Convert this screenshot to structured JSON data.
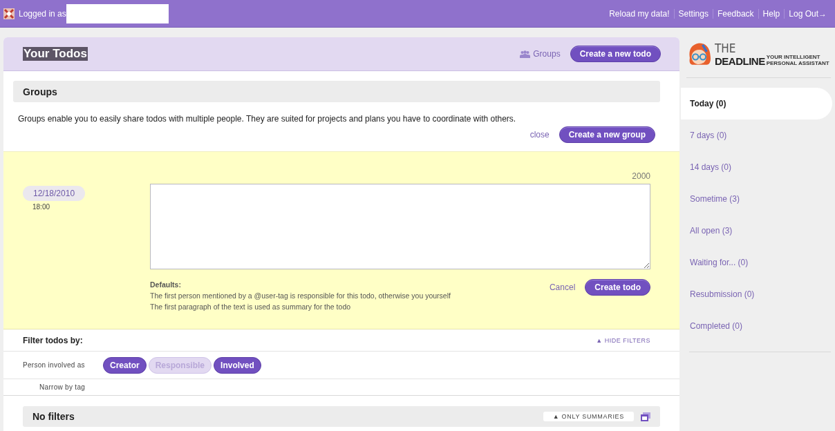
{
  "top_bar": {
    "logged_in_label": "Logged in as",
    "links": [
      "Reload my data!",
      "Settings",
      "Feedback",
      "Help",
      "Log Out→"
    ]
  },
  "header": {
    "title": "Your Todos",
    "groups_link": "Groups",
    "create_button": "Create a new todo"
  },
  "groups_box": {
    "title": "Groups",
    "description": "Groups enable you to easily share todos with multiple people. They are suited for projects and plans you have to coordinate with others.",
    "close": "close",
    "create_button": "Create a new group"
  },
  "new_todo": {
    "date": "12/18/2010",
    "time": "18:00",
    "char_count": "2000",
    "defaults_title": "Defaults:",
    "defaults_lines": [
      "The first person mentioned by a @user-tag is responsible for this todo, otherwise you yourself",
      "The first paragraph of the text is used as summary for the todo"
    ],
    "cancel": "Cancel",
    "submit": "Create todo"
  },
  "filters": {
    "title": "Filter todos by:",
    "hide": "▲ HIDE FILTERS",
    "person_label": "Person involved as",
    "roles": [
      {
        "label": "Creator",
        "selected": true
      },
      {
        "label": "Responsible",
        "selected": false
      },
      {
        "label": "Involved",
        "selected": true
      }
    ],
    "tag_label": "Narrow by tag",
    "summary_title": "No filters",
    "only_summaries": "▲ ONLY SUMMARIES"
  },
  "sidebar": {
    "logo": {
      "the": "THE",
      "name": "DEADLINE",
      "tagline": [
        "YOUR INTELLIGENT",
        "PERSONAL ASSISTANT"
      ]
    },
    "items": [
      {
        "label": "Today (0)",
        "selected": true
      },
      {
        "label": "7 days (0)",
        "selected": false
      },
      {
        "label": "14 days (0)",
        "selected": false
      },
      {
        "label": "Sometime (3)",
        "selected": false
      },
      {
        "label": "All open (3)",
        "selected": false
      },
      {
        "label": "Waiting for... (0)",
        "selected": false
      },
      {
        "label": "Resubmission (0)",
        "selected": false
      },
      {
        "label": "Completed (0)",
        "selected": false
      }
    ]
  }
}
